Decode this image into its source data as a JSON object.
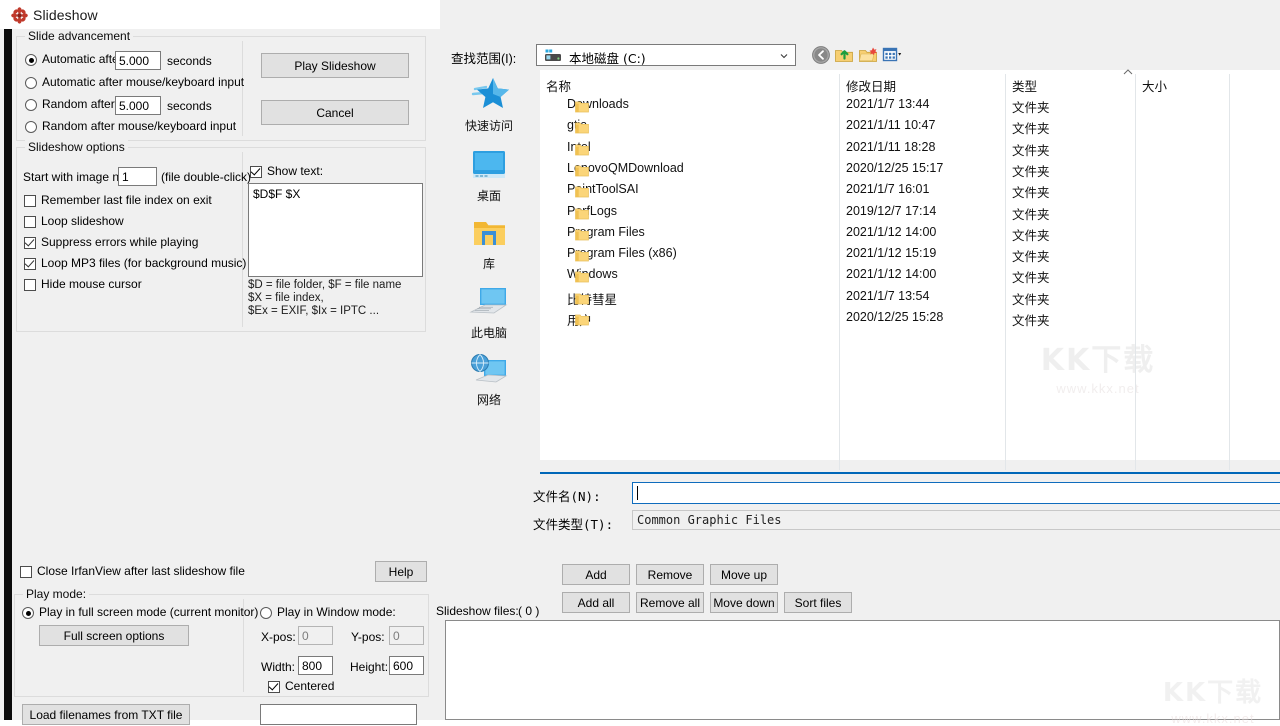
{
  "window": {
    "title": "Slideshow",
    "icon": "irfanview-flower-icon"
  },
  "slide_advancement": {
    "legend": "Slide advancement",
    "options": [
      {
        "label": "Automatic after",
        "selected": true,
        "value": "5.000",
        "unit": "seconds",
        "has_value": true
      },
      {
        "label": "Automatic after mouse/keyboard input",
        "selected": false,
        "has_value": false
      },
      {
        "label": "Random   after",
        "selected": false,
        "value": "5.000",
        "unit": "seconds",
        "has_value": true
      },
      {
        "label": "Random   after mouse/keyboard input",
        "selected": false,
        "has_value": false
      }
    ],
    "play_button": "Play Slideshow",
    "cancel_button": "Cancel"
  },
  "slideshow_options": {
    "legend": "Slideshow options",
    "start_with_label": "Start with image nr.:",
    "start_with_value": "1",
    "start_with_hint": "(file double-click)",
    "checkboxes": [
      {
        "label": "Remember last file index on exit",
        "checked": false
      },
      {
        "label": "Loop slideshow",
        "checked": false
      },
      {
        "label": "Suppress errors while playing",
        "checked": true
      },
      {
        "label": "Loop MP3 files (for background music)",
        "checked": true
      },
      {
        "label": "Hide mouse cursor",
        "checked": false
      }
    ],
    "show_text_label": "Show text:",
    "show_text_checked": true,
    "text_value": "$D$F $X",
    "variables_hint": "$D = file folder, $F = file name\n$X = file index,\n$Ex = EXIF, $Ix = IPTC ..."
  },
  "bottom_left": {
    "close_after_label": "Close IrfanView after last slideshow file",
    "close_after_checked": false,
    "help_button": "Help",
    "play_mode_legend": "Play mode:",
    "fullscreen_radio": "Play in full screen mode (current monitor)",
    "fullscreen_selected": true,
    "fullscreen_options_button": "Full screen options",
    "window_radio": "Play in Window mode:",
    "window_selected": false,
    "xpos_label": "X-pos:",
    "xpos_value": "0",
    "ypos_label": "Y-pos:",
    "ypos_value": "0",
    "width_label": "Width:",
    "width_value": "800",
    "height_label": "Height:",
    "height_value": "600",
    "centered_label": "Centered",
    "centered_checked": true,
    "load_txt_button": "Load filenames from TXT file"
  },
  "file_dialog": {
    "look_in_label": "查找范围(I):",
    "look_in_value": "本地磁盘 (C:)",
    "toolbar": [
      {
        "name": "back-icon"
      },
      {
        "name": "up-folder-icon"
      },
      {
        "name": "new-folder-icon"
      },
      {
        "name": "view-mode-icon"
      }
    ],
    "places": [
      {
        "label": "快速访问",
        "icon": "quick-access-star-icon"
      },
      {
        "label": "桌面",
        "icon": "desktop-icon"
      },
      {
        "label": "库",
        "icon": "library-folder-icon"
      },
      {
        "label": "此电脑",
        "icon": "this-pc-icon"
      },
      {
        "label": "网络",
        "icon": "network-icon"
      }
    ],
    "columns": [
      "名称",
      "修改日期",
      "类型",
      "大小"
    ],
    "rows": [
      {
        "name": "Downloads",
        "date": "2021/1/7 13:44",
        "type": "文件夹",
        "size": ""
      },
      {
        "name": "gtja",
        "date": "2021/1/11 10:47",
        "type": "文件夹",
        "size": ""
      },
      {
        "name": "Intel",
        "date": "2021/1/11 18:28",
        "type": "文件夹",
        "size": ""
      },
      {
        "name": "LenovoQMDownload",
        "date": "2020/12/25 15:17",
        "type": "文件夹",
        "size": ""
      },
      {
        "name": "PaintToolSAI",
        "date": "2021/1/7 16:01",
        "type": "文件夹",
        "size": ""
      },
      {
        "name": "PerfLogs",
        "date": "2019/12/7 17:14",
        "type": "文件夹",
        "size": ""
      },
      {
        "name": "Program Files",
        "date": "2021/1/12 14:00",
        "type": "文件夹",
        "size": ""
      },
      {
        "name": "Program Files (x86)",
        "date": "2021/1/12 15:19",
        "type": "文件夹",
        "size": ""
      },
      {
        "name": "Windows",
        "date": "2021/1/12 14:00",
        "type": "文件夹",
        "size": ""
      },
      {
        "name": "比特彗星",
        "date": "2021/1/7 13:54",
        "type": "文件夹",
        "size": ""
      },
      {
        "name": "用户",
        "date": "2020/12/25 15:28",
        "type": "文件夹",
        "size": ""
      }
    ],
    "filename_label": "文件名(N):",
    "filename_value": "",
    "filetype_label": "文件类型(T):",
    "filetype_value": "Common Graphic Files"
  },
  "file_buttons": {
    "row1": [
      "Add",
      "Remove",
      "Move up"
    ],
    "row2": [
      "Add all",
      "Remove all",
      "Move down",
      "Sort files"
    ]
  },
  "slideshow_files": {
    "label": "Slideshow files:",
    "count": "( 0 )"
  },
  "watermark": {
    "title": "KK下载",
    "url": "www.kkx.net"
  },
  "colors": {
    "dialog_bg": "#f0f0f0",
    "accent_blue": "#0067b8",
    "folder_yellow": "#fbd579",
    "focus_border": "#0f6cbd"
  }
}
